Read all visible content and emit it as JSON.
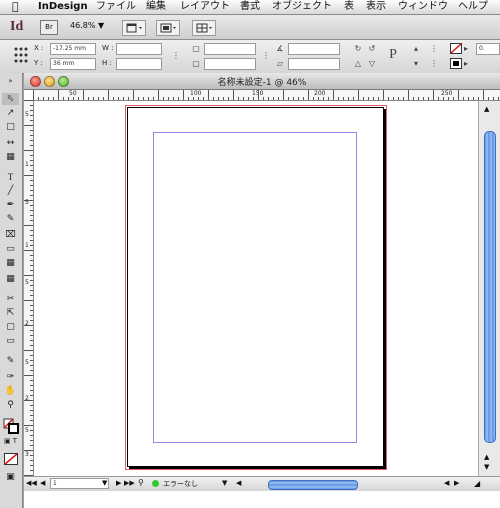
{
  "menubar": {
    "apple": "",
    "app_name": "InDesign",
    "items": [
      "ファイル",
      "編集",
      "レイアウト",
      "書式",
      "オブジェクト",
      "表",
      "表示",
      "ウィンドウ",
      "ヘルプ"
    ]
  },
  "appbar": {
    "logo": "Id",
    "bridge_button": "Br",
    "zoom": "46.8%",
    "zoom_arrow": "▼"
  },
  "control": {
    "x_label": "X :",
    "x_value": "-17.25 mm",
    "y_label": "Y :",
    "y_value": "36 mm",
    "w_label": "W :",
    "h_label": "H :",
    "p_label": "P",
    "stroke_value": "0."
  },
  "document": {
    "title": "名称未設定-1 @ 46%",
    "ruler_labels": [
      "50",
      "100",
      "150",
      "200",
      "250"
    ],
    "vruler_labels": [
      "5",
      "1",
      "5",
      "1",
      "5",
      "2",
      "5",
      "2",
      "5",
      "3"
    ]
  },
  "status": {
    "page_value": "1",
    "error_text": "エラーなし",
    "status_color": "#2ecc2e"
  },
  "colors": {
    "bleed": "#e05a6a",
    "margin": "#8c8cf0",
    "scroll": "#5b8fe0"
  }
}
